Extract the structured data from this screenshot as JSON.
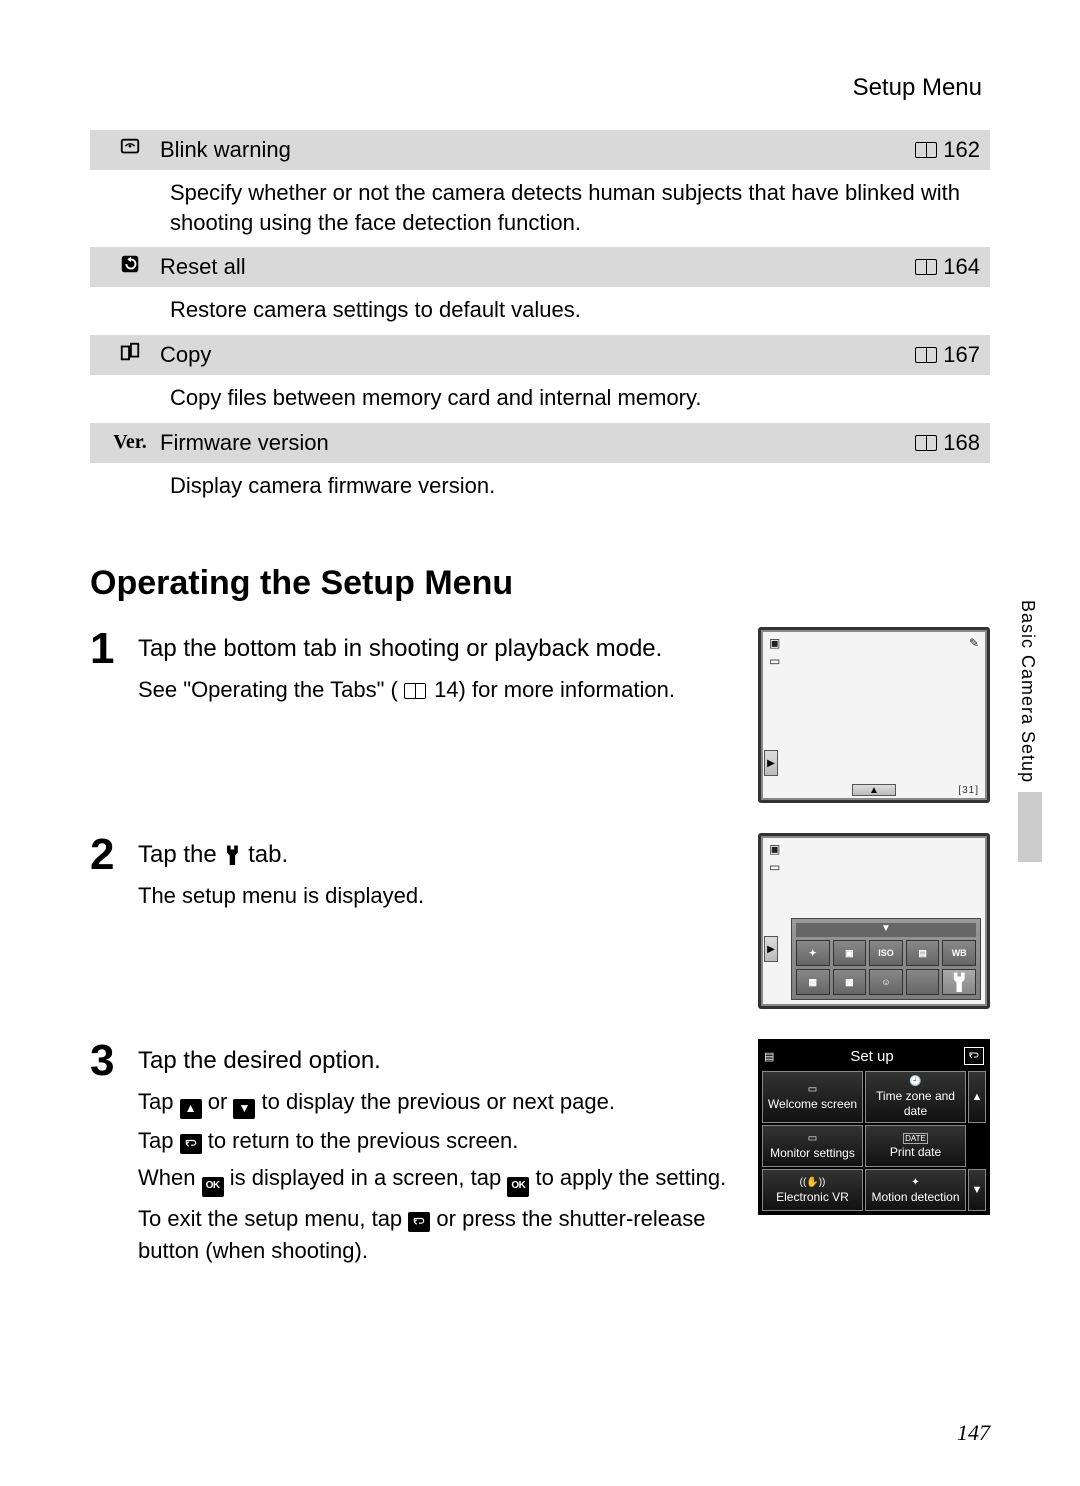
{
  "header": {
    "title": "Setup Menu"
  },
  "table": [
    {
      "label": "Blink warning",
      "page": "162",
      "desc": "Specify whether or not the camera detects human subjects that have blinked with shooting using the face detection function."
    },
    {
      "label": "Reset all",
      "page": "164",
      "desc": "Restore camera settings to default values."
    },
    {
      "label": "Copy",
      "page": "167",
      "desc": "Copy files between memory card and internal memory."
    },
    {
      "label": "Firmware version",
      "page": "168",
      "desc": "Display camera firmware version."
    }
  ],
  "heading": "Operating the Setup Menu",
  "steps": {
    "s1": {
      "num": "1",
      "title": "Tap the bottom tab in shooting or playback mode.",
      "text_a": "See \"Operating the Tabs\" (",
      "text_b": " 14) for more information."
    },
    "s2": {
      "num": "2",
      "title_a": "Tap the ",
      "title_b": " tab.",
      "text": "The setup menu is displayed."
    },
    "s3": {
      "num": "3",
      "title": "Tap the desired option.",
      "line1_a": "Tap ",
      "line1_b": " or ",
      "line1_c": " to display the previous or next page.",
      "line2_a": "Tap ",
      "line2_b": " to return to the previous screen.",
      "line3_a": "When ",
      "line3_b": " is displayed in a screen, tap ",
      "line3_c": " to apply the setting.",
      "line4_a": "To exit the setup menu, tap ",
      "line4_b": " or press the shutter-release button (when shooting)."
    }
  },
  "lcd1": {
    "corner": "31"
  },
  "setup_screen": {
    "title": "Set up",
    "options": [
      {
        "icon": "welcome-icon",
        "label": "Welcome screen"
      },
      {
        "icon": "clock-icon",
        "label": "Time zone and date"
      },
      {
        "icon": "monitor-icon",
        "label": "Monitor settings"
      },
      {
        "icon": "date-icon",
        "label": "Print date"
      },
      {
        "icon": "vr-icon",
        "label": "Electronic VR"
      },
      {
        "icon": "motion-icon",
        "label": "Motion detection"
      }
    ]
  },
  "side_label": "Basic Camera Setup",
  "page_number": "147",
  "ver_label": "Ver."
}
